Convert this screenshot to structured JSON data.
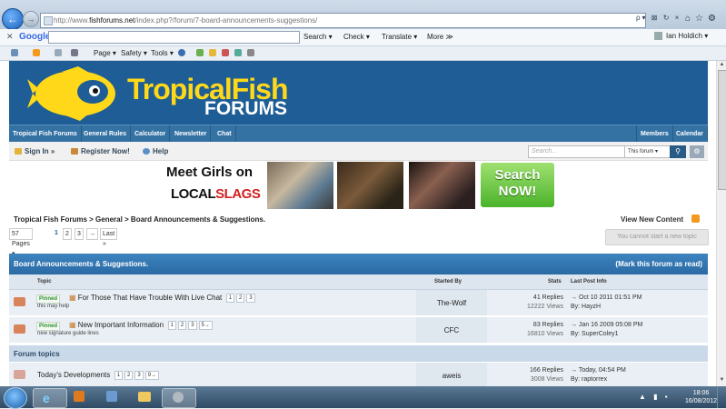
{
  "browser": {
    "url_prefix": "http://www.",
    "url_domain": "fishforums.net",
    "url_rest": "/index.php?/forum/7-board-announcements-suggestions/",
    "addr_tools": "ρ▾ ⊠ ↻ ×",
    "google_label": "Google",
    "google_search_btn": "Search ▾",
    "check_btn": "Check ▾",
    "translate_btn": "Translate ▾",
    "more_btn": "More ≫",
    "user_name": "Ian Holdich ▾",
    "cmd_page": "Page ▾",
    "cmd_safety": "Safety ▾",
    "cmd_tools": "Tools ▾"
  },
  "site": {
    "logo_title": "TropicalFish",
    "logo_sub": "FORUMS",
    "nav": [
      "Tropical Fish Forums",
      "General Rules",
      "Calculator",
      "Newsletter",
      "Chat"
    ],
    "nav_right": [
      "Members",
      "Calendar"
    ],
    "sign_in": "Sign In »",
    "register": "Register Now!",
    "help": "Help",
    "search_placeholder": "Search...",
    "search_scope": "This forum ▾"
  },
  "ad": {
    "line1": "Meet Girls on",
    "local": "LOCAL",
    "slags": "SLAGS",
    "btn1": "Search",
    "btn2": "NOW!"
  },
  "breadcrumb": "Tropical Fish Forums  >  General  >  Board Announcements & Suggestions.",
  "view_new": "View New Content",
  "pager": {
    "pages_label": "57 Pages ▾",
    "pages": [
      "1",
      "2",
      "3"
    ],
    "next": "→",
    "last": "Last »"
  },
  "cant_start": "You cannot start a new topic",
  "forum": {
    "title": "Board Announcements & Suggestions.",
    "mark_read": "(Mark this forum as read)",
    "col_topic": "Topic",
    "col_started": "Started By",
    "col_stats": "Stats",
    "col_last": "Last Post Info",
    "section_label": "Forum topics"
  },
  "topics": [
    {
      "badge": "Pinned",
      "title": "For Those That Have Trouble With Live Chat",
      "pages": [
        "1",
        "2",
        "3"
      ],
      "subtitle": "this may help",
      "starter": "The-Wolf",
      "replies": "41 Replies",
      "views": "12222 Views",
      "last_date": "→ Oct 10 2011 01:51 PM",
      "last_by": "By: HayzH"
    },
    {
      "badge": "Pinned",
      "title": "New Important Information",
      "pages": [
        "1",
        "2",
        "3",
        "5→"
      ],
      "subtitle": "new signature guide lines",
      "starter": "CFC",
      "replies": "83 Replies",
      "views": "16810 Views",
      "last_date": "→ Jan 16 2009 05:08 PM",
      "last_by": "By: SuperColey1"
    },
    {
      "badge": "",
      "title": "Today's Developments",
      "pages": [
        "1",
        "2",
        "3",
        "9→"
      ],
      "subtitle": "",
      "starter": "aweis",
      "replies": "166 Replies",
      "views": "3008 Views",
      "last_date": "→ Today, 04:54 PM",
      "last_by": "By: raptorrex"
    }
  ],
  "taskbar": {
    "time": "18:06",
    "date": "16/08/2012"
  },
  "colors": {
    "header_blue": "#1e5d95",
    "logo_yellow": "#ffd81a",
    "pinned_green": "#2f8f2f",
    "ad_button_green": "#4bb32a"
  }
}
